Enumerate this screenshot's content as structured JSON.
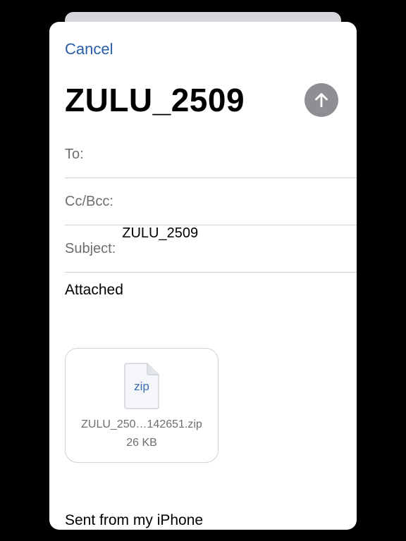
{
  "header": {
    "cancel_label": "Cancel",
    "title": "ZULU_2509",
    "send_icon": "arrow-up-icon"
  },
  "fields": {
    "to_label": "To:",
    "to_value": "",
    "ccbcc_label": "Cc/Bcc:",
    "ccbcc_value": "",
    "subject_label": "Subject:",
    "subject_value": "ZULU_2509"
  },
  "body": {
    "text": "Attached",
    "signature": "Sent from my iPhone"
  },
  "attachment": {
    "icon": "zip-file-icon",
    "extension": "zip",
    "filename": "ZULU_250…142651.zip",
    "size": "26 KB"
  },
  "colors": {
    "accent": "#2a5ea8",
    "send_button": "#8e8e93",
    "separator": "#d1d1d6",
    "label": "#6d6d72"
  }
}
